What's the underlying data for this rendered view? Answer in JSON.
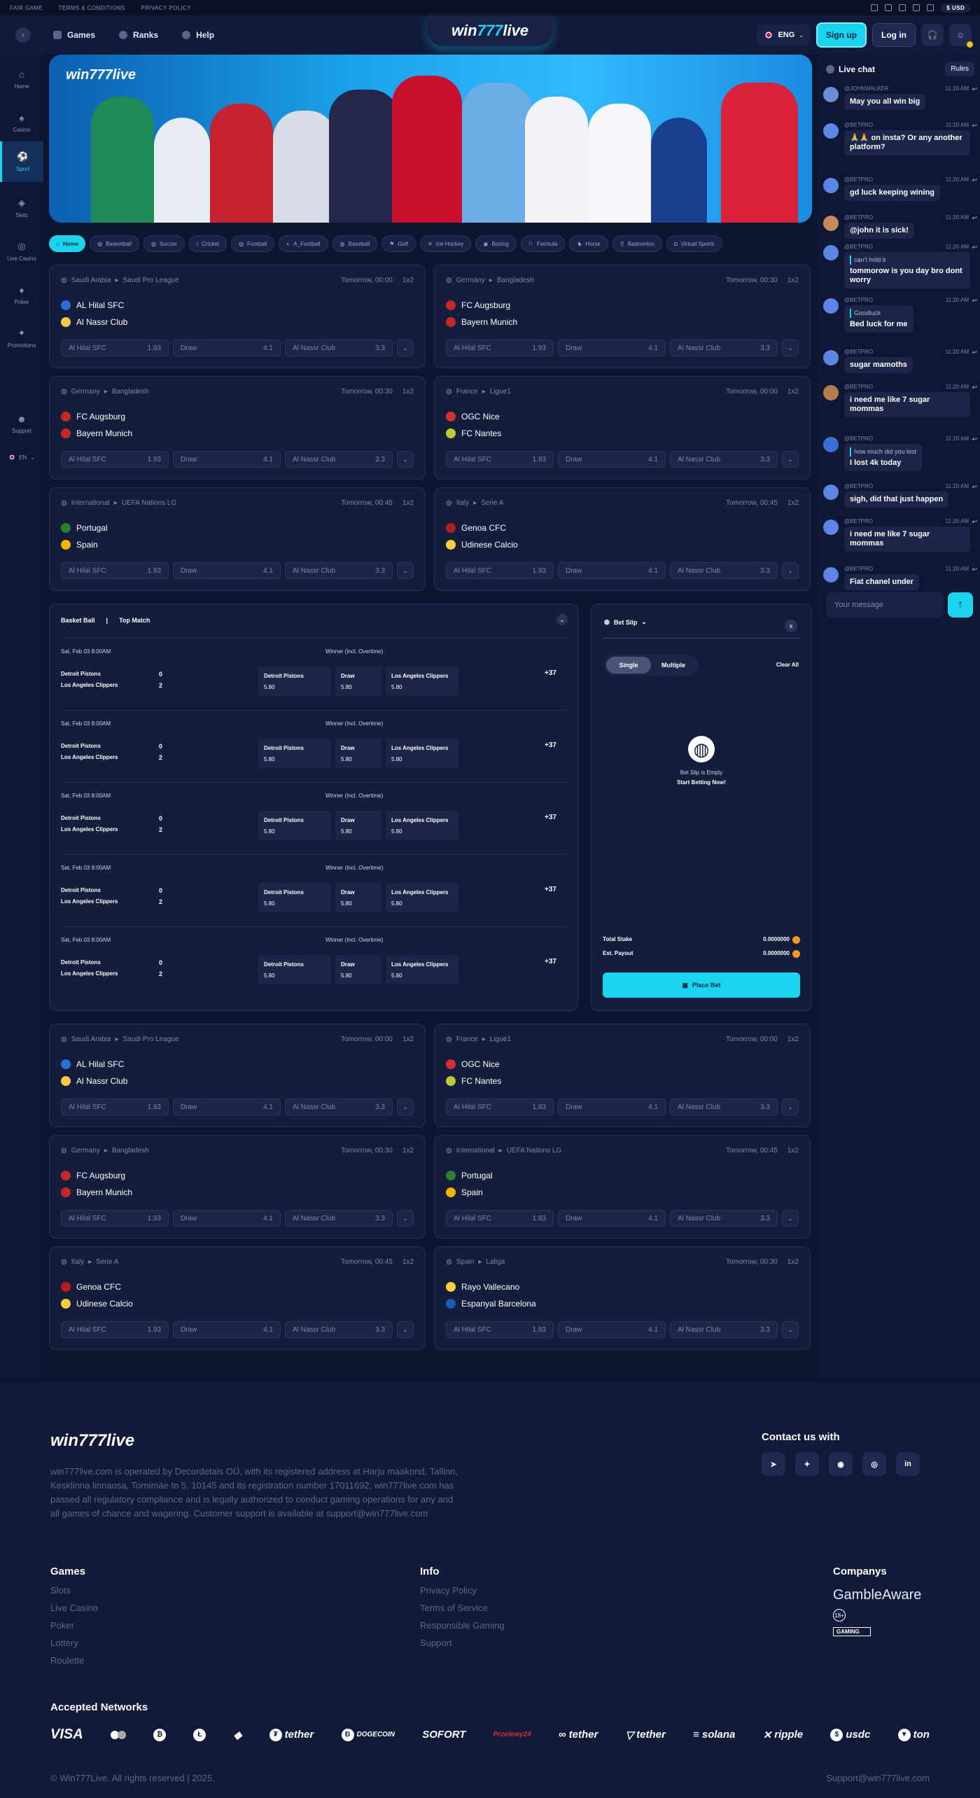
{
  "topbar": {
    "links": [
      "FAIR GAME",
      "TERMS & CONDITIONS",
      "PRIVACY POLICY"
    ],
    "currency": "USD"
  },
  "header": {
    "nav": [
      "Games",
      "Ranks",
      "Help"
    ],
    "logo_pre": "win",
    "logo_mid": "777",
    "logo_post": "live",
    "lang": "ENG",
    "signup": "Sign up",
    "login": "Log in"
  },
  "sidebar": {
    "items": [
      "Home",
      "Casino",
      "Sport",
      "Slots",
      "Live Casino",
      "Poker",
      "Promotions",
      "Support"
    ],
    "lang": "EN"
  },
  "banner": {
    "logo": "win777live"
  },
  "chips": [
    "Home",
    "Basketball",
    "Soccer",
    "Cricket",
    "Football",
    "A_Football",
    "Baseball",
    "Golf",
    "Ice Hockey",
    "Boxing",
    "Formula",
    "Horse",
    "Badminton",
    "Virtual Sports"
  ],
  "odds_labels": {
    "home": "Al Hilal SFC",
    "draw": "Draw",
    "away": "Al Nassr Club",
    "home_v": "1.93",
    "draw_v": "4.1",
    "away_v": "3.3"
  },
  "matches": [
    {
      "country": "Saudi Arabia",
      "league": "Saudi Pro League",
      "time": "Tomorrow, 00:00",
      "mkt": "1x2",
      "t1": "AL Hilal SFC",
      "t2": "Al Nassr Club"
    },
    {
      "country": "Germany",
      "league": "Bangladesh",
      "time": "Tomorrow, 00:30",
      "mkt": "1x2",
      "t1": "FC Augsburg",
      "t2": "Bayern Munich"
    },
    {
      "country": "Germany",
      "league": "Bangladesh",
      "time": "Tomorrow, 00:30",
      "mkt": "1x2",
      "t1": "FC Augsburg",
      "t2": "Bayern Munich"
    },
    {
      "country": "France",
      "league": "Ligue1",
      "time": "Tomorrow, 00:00",
      "mkt": "1x2",
      "t1": "OGC Nice",
      "t2": "FC Nantes"
    },
    {
      "country": "International",
      "league": "UEFA Nations LG",
      "time": "Tomorrow, 00:45",
      "mkt": "1x2",
      "t1": "Portugal",
      "t2": "Spain"
    },
    {
      "country": "Italy",
      "league": "Serie A",
      "time": "Tomorrow, 00:45",
      "mkt": "1x2",
      "t1": "Genoa CFC",
      "t2": "Udinese Calcio"
    },
    {
      "country": "Saudi Arabia",
      "league": "Saudi Pro League",
      "time": "Tomorrow, 00:00",
      "mkt": "1x2",
      "t1": "AL Hilal SFC",
      "t2": "Al Nassr Club"
    },
    {
      "country": "France",
      "league": "Ligue1",
      "time": "Tomorrow, 00:00",
      "mkt": "1x2",
      "t1": "OGC Nice",
      "t2": "FC Nantes"
    },
    {
      "country": "Germany",
      "league": "Bangladesh",
      "time": "Tomorrow, 00:30",
      "mkt": "1x2",
      "t1": "FC Augsburg",
      "t2": "Bayern Munich"
    },
    {
      "country": "International",
      "league": "UEFA Nations LG",
      "time": "Tomorrow, 00:45",
      "mkt": "1x2",
      "t1": "Portugal",
      "t2": "Spain"
    },
    {
      "country": "Italy",
      "league": "Serie A",
      "time": "Tomorrow, 00:45",
      "mkt": "1x2",
      "t1": "Genoa CFC",
      "t2": "Udinese Calcio"
    },
    {
      "country": "Spain",
      "league": "Laliga",
      "time": "Tomorrow, 00:30",
      "mkt": "1x2",
      "t1": "Rayo Vallecano",
      "t2": "Espanyal Barcelona"
    }
  ],
  "basket": {
    "tab1": "Basket Ball",
    "sep": "|",
    "tab2": "Top Match",
    "date": "Sat, Feb 03 8:00AM",
    "winner": "Winner (Incl. Overtime)",
    "t1": "Detroit Pistons",
    "t2": "Los Angeles Clippers",
    "s1": "0",
    "s2": "2",
    "o1": "Detroit Pistons",
    "o2": "Draw",
    "o3": "Los Angeles Clippers",
    "v": "5.80",
    "more": "+37"
  },
  "slip": {
    "title": "Bet Slip",
    "single": "Single",
    "multiple": "Multiple",
    "clear": "Clear All",
    "empty": "Bet Slip is Empty",
    "start": "Start Betting Now!",
    "stake_l": "Total Stake",
    "stake_v": "0.0000000",
    "payout_l": "Est. Payout",
    "payout_v": "0.0000000",
    "place": "Place Bet",
    "close": "x"
  },
  "chat": {
    "title": "Live chat",
    "rules": "Rules",
    "placeholder": "Your message",
    "messages": [
      {
        "user": "@JOHNWALKER",
        "time": "11:20 AM",
        "quote": "",
        "text": "May you all win big"
      },
      {
        "user": "@BETPRO",
        "time": "11:20 AM",
        "quote": "",
        "text": "🙏🙏 on insta? Or any another platform?"
      },
      {
        "user": "@BETPRO",
        "time": "11:20 AM",
        "quote": "",
        "text": "gd luck keeping wining"
      },
      {
        "user": "@BETPRO",
        "time": "11:20 AM",
        "quote": "",
        "text": "@john it is sick!"
      },
      {
        "user": "@BETPRO",
        "time": "11:20 AM",
        "quote": "can't hold it",
        "text": "tommorow is you day bro dont worry"
      },
      {
        "user": "@BETPRO",
        "time": "11:20 AM",
        "quote": "Goodluck",
        "text": "Bed luck for me"
      },
      {
        "user": "@BETPRO",
        "time": "11:20 AM",
        "quote": "",
        "text": "sugar mamoths"
      },
      {
        "user": "@BETPRO",
        "time": "11:20 AM",
        "quote": "",
        "text": "i need me like 7 sugar mommas"
      },
      {
        "user": "@BETPRO",
        "time": "11:20 AM",
        "quote": "how much did you lost",
        "text": "I lost 4k today"
      },
      {
        "user": "@BETPRO",
        "time": "11:20 AM",
        "quote": "",
        "text": "sigh, did that just happen"
      },
      {
        "user": "@BETPRO",
        "time": "11:20 AM",
        "quote": "",
        "text": "i need me like 7 sugar mommas"
      },
      {
        "user": "@BETPRO",
        "time": "11:20 AM",
        "quote": "",
        "text": "Fiat chanel under"
      }
    ]
  },
  "footer": {
    "logo": "win777live",
    "about": "win777live.com is operated by Decordetals OÜ, with its registered address at Harju maakond, Tallinn, Kesklinna linnaosa, Tornimäe tn 5, 10145 and its registration number 17011692, win777live.com has passed all regulatory compliance and is legally authorized to conduct gaming operations for any and all games of chance and wagering. Customer support is available at support@win777live.com",
    "contact": "Contact us with",
    "games_t": "Games",
    "games": [
      "Slots",
      "Live Casino",
      "Poker",
      "Lottery",
      "Roulette"
    ],
    "info_t": "Info",
    "info": [
      "Privacy Policy",
      "Terms of Service",
      "Responsible Gaming",
      "Support"
    ],
    "companies_t": "Companys",
    "gamble": "GambleAware",
    "age": "18+",
    "gaming": "GAMING",
    "networks_t": "Accepted Networks",
    "networks": [
      "VISA",
      "tether",
      "DOGECOIN",
      "SOFORT",
      "tether",
      "tether",
      "solana",
      "ripple",
      "usdc",
      "ton"
    ],
    "copy": "© Win777Live. All rights reserved | 2025.",
    "support": "Support@win777live.com"
  }
}
